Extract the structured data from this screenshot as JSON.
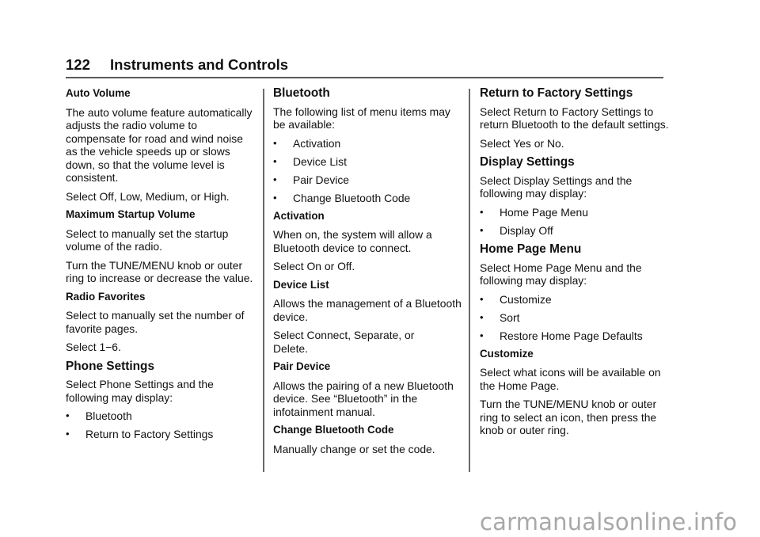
{
  "header": {
    "page_number": "122",
    "chapter_title": "Instruments and Controls"
  },
  "column1": {
    "auto_volume": {
      "heading": "Auto Volume",
      "body": "The auto volume feature automatically adjusts the radio volume to compensate for road and wind noise as the vehicle speeds up or slows down, so that the volume level is consistent.",
      "options": "Select Off, Low, Medium, or High."
    },
    "max_startup_volume": {
      "heading": "Maximum Startup Volume",
      "body": "Select to manually set the startup volume of the radio.",
      "instruction": "Turn the TUNE/MENU knob or outer ring to increase or decrease the value."
    },
    "radio_favorites": {
      "heading": "Radio Favorites",
      "body": "Select to manually set the number of favorite pages.",
      "range": "Select 1−6."
    },
    "phone_settings": {
      "heading": "Phone Settings",
      "body": "Select Phone Settings and the following may display:",
      "items": [
        "Bluetooth",
        "Return to Factory Settings"
      ]
    }
  },
  "column2": {
    "bluetooth": {
      "heading": "Bluetooth",
      "body": "The following list of menu items may be available:",
      "items": [
        "Activation",
        "Device List",
        "Pair Device",
        "Change Bluetooth Code"
      ]
    },
    "activation": {
      "heading": "Activation",
      "body": "When on, the system will allow a Bluetooth device to connect.",
      "options": "Select On or Off."
    },
    "device_list": {
      "heading": "Device List",
      "body": "Allows the management of a Bluetooth device.",
      "options": "Select Connect, Separate, or Delete."
    },
    "pair_device": {
      "heading": "Pair Device",
      "body": "Allows the pairing of a new Bluetooth device. See “Bluetooth” in the infotainment manual."
    },
    "change_code": {
      "heading": "Change Bluetooth Code",
      "body": "Manually change or set the code."
    }
  },
  "column3": {
    "factory_settings": {
      "heading": "Return to Factory Settings",
      "body": "Select Return to Factory Settings to return Bluetooth to the default settings.",
      "options": "Select Yes or No."
    },
    "display_settings": {
      "heading": "Display Settings",
      "body": "Select Display Settings and the following may display:",
      "items": [
        "Home Page Menu",
        "Display Off"
      ]
    },
    "home_page_menu": {
      "heading": "Home Page Menu",
      "body": "Select Home Page Menu and the following may display:",
      "items": [
        "Customize",
        "Sort",
        "Restore Home Page Defaults"
      ]
    },
    "customize": {
      "heading": "Customize",
      "body": "Select what icons will be available on the Home Page.",
      "instruction": "Turn the TUNE/MENU knob or outer ring to select an icon, then press the knob or outer ring."
    }
  },
  "bullet_glyph": "•",
  "watermark": "carmanualsonline.info"
}
